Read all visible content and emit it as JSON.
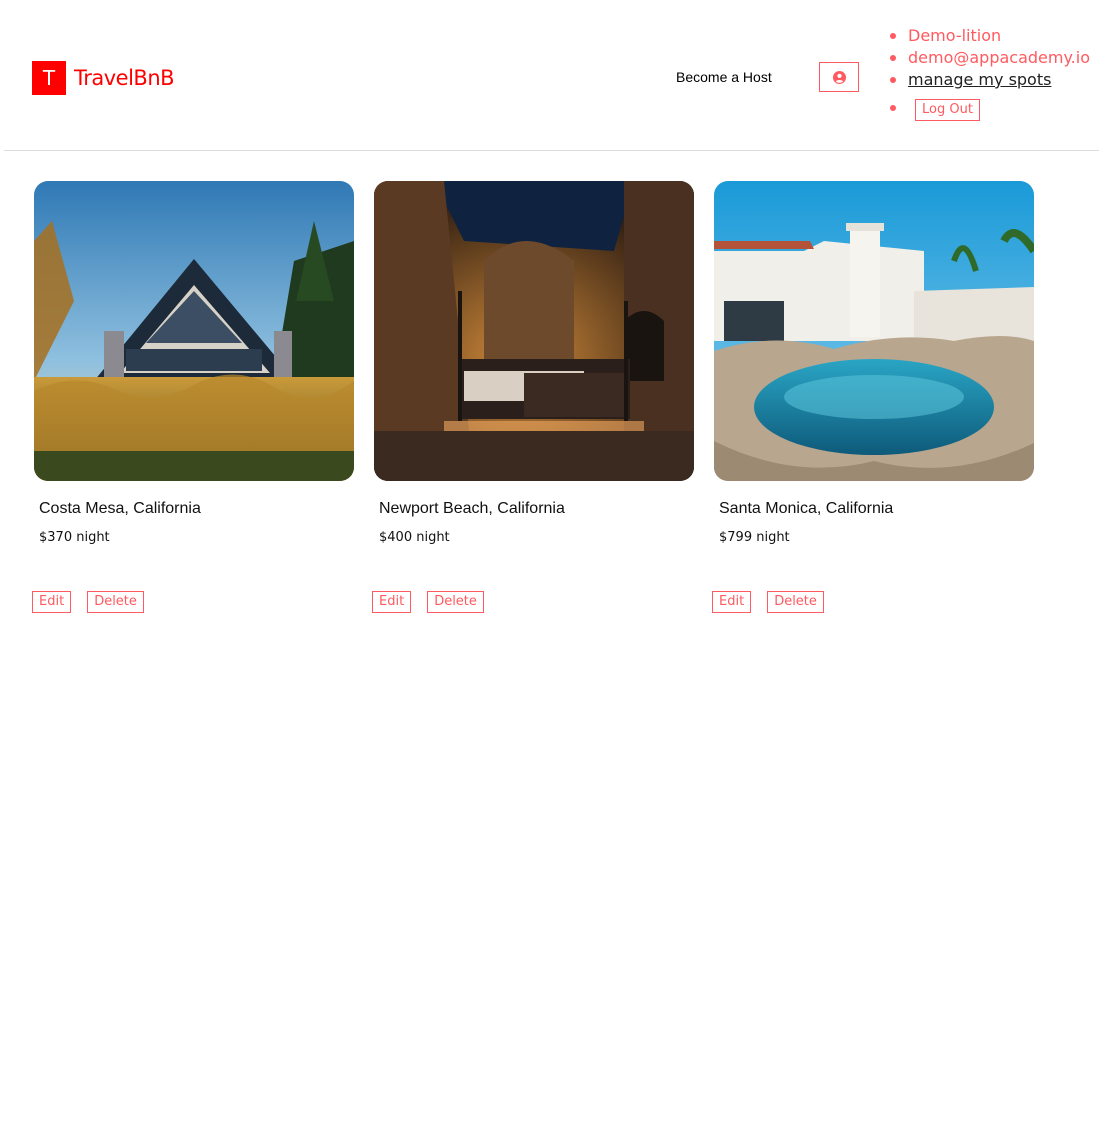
{
  "header": {
    "logo_letter": "T",
    "logo_text": "TravelBnB",
    "become_host": "Become a Host",
    "profile_icon": "user-circle-icon",
    "user_menu": {
      "name": "Demo-lition",
      "email": "demo@appacademy.io",
      "manage": "manage my spots",
      "logout": "Log Out"
    }
  },
  "colors": {
    "brand": "#ff0000",
    "accent": "#ff5a5f"
  },
  "spots": [
    {
      "location": "Costa Mesa, California",
      "price": "$370 night",
      "edit": "Edit",
      "delete": "Delete",
      "photo": "a-frame-cabin-photo"
    },
    {
      "location": "Newport Beach, California",
      "price": "$400 night",
      "edit": "Edit",
      "delete": "Delete",
      "photo": "cave-bedroom-photo"
    },
    {
      "location": "Santa Monica, California",
      "price": "$799 night",
      "edit": "Edit",
      "delete": "Delete",
      "photo": "villa-pool-photo"
    }
  ]
}
